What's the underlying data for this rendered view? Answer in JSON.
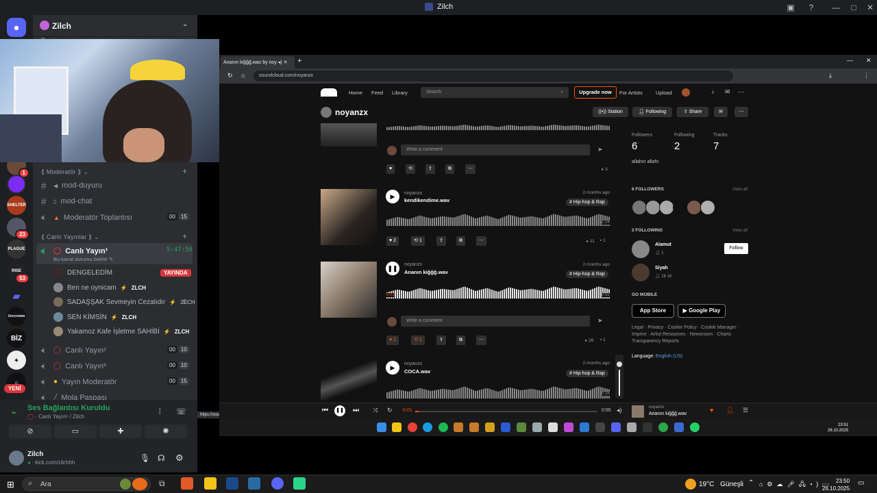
{
  "window": {
    "title": "Zilch"
  },
  "server": {
    "name": "Zilch",
    "partial_channel": "Tanıtım"
  },
  "rail": {
    "badges": [
      "1",
      "23",
      "53"
    ],
    "labels": [
      "SHELTER",
      "PLAGUE",
      "RISE",
      "Ucrcrsmm",
      "BİZ"
    ],
    "new_label": "YENİ"
  },
  "categories": {
    "moderator": "Moderatör",
    "live": "Canlı Yayınlar"
  },
  "channels": {
    "mod_duyuru": "mod-duyuru",
    "mod_chat": "mod-chat",
    "mod_meeting": "Moderatör Toplantısı",
    "mod_meeting_counts": [
      "00",
      "15"
    ],
    "live1": "Canlı Yayın¹",
    "live1_timer": "5:47:56",
    "live1_status": "Bu kanal durumu belirle",
    "live2": "Canlı Yayın²",
    "live2_counts": [
      "00",
      "10"
    ],
    "live3": "Canlı Yayın³",
    "live3_counts": [
      "00",
      "10"
    ],
    "yayin_mod": "Yayın Moderatör",
    "yayin_mod_counts": [
      "00",
      "15"
    ],
    "mola": "Mola Paşpası"
  },
  "members": [
    {
      "name": "DENGELEDİM",
      "badge": "YAYINDA"
    },
    {
      "name": "Ben ne oynicam",
      "badge": "ZLCH"
    },
    {
      "name": "SADAŞŞAK Sevmeyin Cezalıdır",
      "badge": "ZLCH"
    },
    {
      "name": "SEN KİMSİN",
      "badge": "ZLCH"
    },
    {
      "name": "Yakamoz Kafe İşletme SAHİBİ",
      "badge": "ZLCH"
    }
  ],
  "voice": {
    "status": "Ses Bağlantısı Kuruldu",
    "location": "Canlı Yayın¹ / Zilch"
  },
  "user": {
    "name": "Zilch",
    "status": "kick.com/zilchhh"
  },
  "browser": {
    "tab_title": "Ananın kiğğğ.wav by noy",
    "url": "soundcloud.com/noyanzx",
    "hover_url": "https://soundcloud.com/noyanzx"
  },
  "soundcloud": {
    "nav": [
      "Home",
      "Feed",
      "Library"
    ],
    "search_placeholder": "Search",
    "upgrade": "Upgrade now",
    "for_artists": "For Artists",
    "upload": "Upload",
    "profile_name": "noyanzx",
    "buttons": {
      "station": "Station",
      "following": "Following",
      "share": "Share"
    },
    "comment_placeholder": "Write a comment",
    "tracks": [
      {
        "artist": "noyanzx",
        "title": "kendikendime.wav",
        "ago": "2 months ago",
        "tag": "# Hip-hop & Rap",
        "likes": "2",
        "reposts": "1",
        "plays": "11",
        "comments": "1",
        "duration": "1:24"
      },
      {
        "artist": "noyanzx",
        "title": "Ananın kiğğğ.wav",
        "ago": "2 months ago",
        "tag": "# Hip-hop & Rap",
        "likes": "2",
        "reposts": "1",
        "plays": "26",
        "comments": "1",
        "elapsed": "0:01",
        "duration": "0:55"
      },
      {
        "artist": "noyanzx",
        "title": "COCA.wav",
        "ago": "2 months ago",
        "tag": "# Hip-hop & Rap",
        "duration": "0:26"
      }
    ],
    "first_track_plays": "3",
    "stats": [
      {
        "label": "Followers",
        "value": "6"
      },
      {
        "label": "Following",
        "value": "2"
      },
      {
        "label": "Tracks",
        "value": "7"
      }
    ],
    "bio": "allahın allahı",
    "followers_title": "6 FOLLOWERS",
    "view_all": "View all",
    "following_title": "2 FOLLOWING",
    "following": [
      {
        "name": "Alamut",
        "stats": "1"
      },
      {
        "name": "Siyah",
        "stats": "16   16"
      }
    ],
    "follow_btn": "Follow",
    "go_mobile": "GO MOBILE",
    "app_store": "App Store",
    "google_play": "Google Play",
    "footer": "Legal · Privacy · Cookie Policy · Cookie Manager · Imprint · Artist Resources · Newsroom · Charts · Transparency Reports",
    "language_label": "Language:",
    "language": "English (US)",
    "player": {
      "elapsed": "0:01",
      "duration": "0:55",
      "artist": "noyanzx",
      "title": "Ananın kiğğğ.wav"
    }
  },
  "inner_taskbar": {
    "time": "23:51",
    "date": "26.10.2025"
  },
  "taskbar": {
    "search": "Ara",
    "weather": "19°C",
    "weather_desc": "Güneşli",
    "time": "23:50",
    "date": "26.10.2025"
  }
}
